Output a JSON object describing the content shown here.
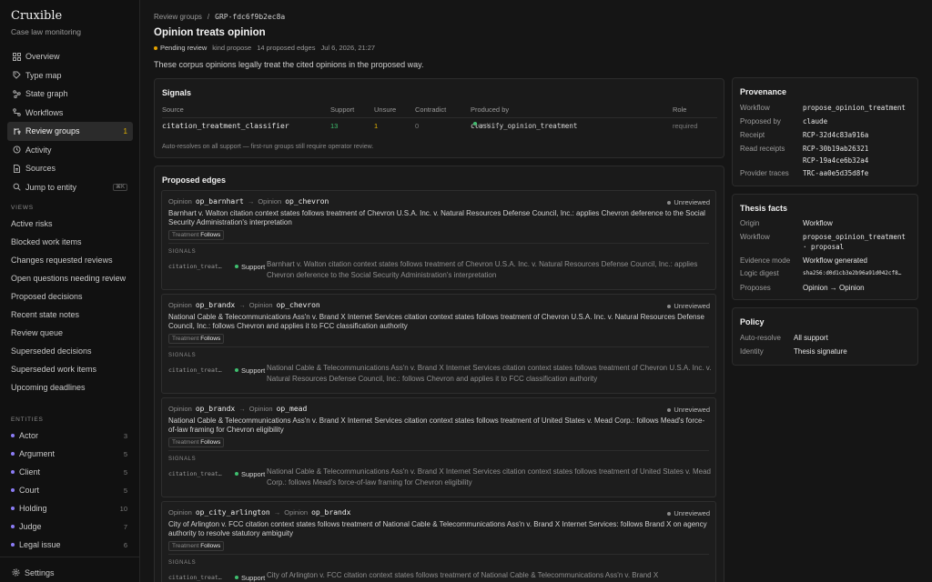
{
  "app": {
    "name": "Cruxible",
    "subtitle": "Case law monitoring"
  },
  "nav": [
    {
      "label": "Overview",
      "icon": "grid-icon"
    },
    {
      "label": "Type map",
      "icon": "tag-icon"
    },
    {
      "label": "State graph",
      "icon": "graph-icon"
    },
    {
      "label": "Workflows",
      "icon": "workflow-icon"
    },
    {
      "label": "Review groups",
      "icon": "merge-icon",
      "count": "1",
      "active": true
    },
    {
      "label": "Activity",
      "icon": "history-icon"
    },
    {
      "label": "Sources",
      "icon": "file-icon"
    },
    {
      "label": "Jump to entity",
      "icon": "search-icon",
      "kbd": "⌘K"
    }
  ],
  "views": {
    "label": "VIEWS",
    "items": [
      "Active risks",
      "Blocked work items",
      "Changes requested reviews",
      "Open questions needing review",
      "Proposed decisions",
      "Recent state notes",
      "Review queue",
      "Superseded decisions",
      "Superseded work items",
      "Upcoming deadlines"
    ]
  },
  "entities": {
    "label": "ENTITIES",
    "items": [
      {
        "label": "Actor",
        "count": "3"
      },
      {
        "label": "Argument",
        "count": "5"
      },
      {
        "label": "Client",
        "count": "5"
      },
      {
        "label": "Court",
        "count": "5"
      },
      {
        "label": "Holding",
        "count": "10"
      },
      {
        "label": "Judge",
        "count": "7"
      },
      {
        "label": "Legal issue",
        "count": "6"
      }
    ]
  },
  "settings_label": "Settings",
  "breadcrumb": {
    "parent": "Review groups",
    "sep": "/",
    "id": "GRP-fdc6f9b2ec8a"
  },
  "page": {
    "title": "Opinion treats opinion",
    "status": "Pending review",
    "kind": "kind propose",
    "edges_count": "14 proposed edges",
    "date": "Jul 6, 2026, 21:27",
    "description": "These corpus opinions legally treat the cited opinions in the proposed way."
  },
  "signals": {
    "title": "Signals",
    "headers": {
      "source": "Source",
      "support": "Support",
      "unsure": "Unsure",
      "contradict": "Contradict",
      "produced_by": "Produced by",
      "role": "Role"
    },
    "row": {
      "source": "citation_treatment_classifier",
      "support": "13",
      "unsure": "1",
      "contradict": "0",
      "produced_by": "classify_opinion_treatment",
      "verdict": ".verdict",
      "role": "required"
    },
    "note": "Auto-resolves on all support — first-run groups still require operator review."
  },
  "edges": {
    "title": "Proposed edges",
    "items": [
      {
        "from_label": "Opinion",
        "from": "op_barnhart",
        "to_label": "Opinion",
        "to": "op_chevron",
        "status": "Unreviewed",
        "text": "Barnhart v. Walton citation context states follows treatment of Chevron U.S.A. Inc. v. Natural Resources Defense Council, Inc.: applies Chevron deference to the Social Security Administration's interpretation",
        "chip_label": "Treatment",
        "chip_value": "Follows",
        "signals_label": "SIGNALS",
        "sig_source": "citation_treat…",
        "sig_verdict": "Support",
        "sig_text": "Barnhart v. Walton citation context states follows treatment of Chevron U.S.A. Inc. v. Natural Resources Defense Council, Inc.: applies Chevron deference to the Social Security Administration's interpretation"
      },
      {
        "from_label": "Opinion",
        "from": "op_brandx",
        "to_label": "Opinion",
        "to": "op_chevron",
        "status": "Unreviewed",
        "text": "National Cable & Telecommunications Ass'n v. Brand X Internet Services citation context states follows treatment of Chevron U.S.A. Inc. v. Natural Resources Defense Council, Inc.: follows Chevron and applies it to FCC classification authority",
        "chip_label": "Treatment",
        "chip_value": "Follows",
        "signals_label": "SIGNALS",
        "sig_source": "citation_treat…",
        "sig_verdict": "Support",
        "sig_text": "National Cable & Telecommunications Ass'n v. Brand X Internet Services citation context states follows treatment of Chevron U.S.A. Inc. v. Natural Resources Defense Council, Inc.: follows Chevron and applies it to FCC classification authority"
      },
      {
        "from_label": "Opinion",
        "from": "op_brandx",
        "to_label": "Opinion",
        "to": "op_mead",
        "status": "Unreviewed",
        "text": "National Cable & Telecommunications Ass'n v. Brand X Internet Services citation context states follows treatment of United States v. Mead Corp.: follows Mead's force-of-law framing for Chevron eligibility",
        "chip_label": "Treatment",
        "chip_value": "Follows",
        "signals_label": "SIGNALS",
        "sig_source": "citation_treat…",
        "sig_verdict": "Support",
        "sig_text": "National Cable & Telecommunications Ass'n v. Brand X Internet Services citation context states follows treatment of United States v. Mead Corp.: follows Mead's force-of-law framing for Chevron eligibility"
      },
      {
        "from_label": "Opinion",
        "from": "op_city_arlington",
        "to_label": "Opinion",
        "to": "op_brandx",
        "status": "Unreviewed",
        "text": "City of Arlington v. FCC citation context states follows treatment of National Cable & Telecommunications Ass'n v. Brand X Internet Services: follows Brand X on agency authority to resolve statutory ambiguity",
        "chip_label": "Treatment",
        "chip_value": "Follows",
        "signals_label": "SIGNALS",
        "sig_source": "citation_treat…",
        "sig_verdict": "Support",
        "sig_text": "City of Arlington v. FCC citation context states follows treatment of National Cable & Telecommunications Ass'n v. Brand X"
      }
    ]
  },
  "provenance": {
    "title": "Provenance",
    "workflow_k": "Workflow",
    "workflow_v": "propose_opinion_treatment",
    "proposed_k": "Proposed by",
    "proposed_v": "claude",
    "receipt_k": "Receipt",
    "receipt_v": "RCP-32d4c83a916a",
    "read_k": "Read receipts",
    "read_v1": "RCP-30b19ab26321",
    "read_v2": "RCP-19a4ce6b32a4",
    "trace_k": "Provider traces",
    "trace_v": "TRC-aa0e5d35d8fe"
  },
  "thesis": {
    "title": "Thesis facts",
    "origin_k": "Origin",
    "origin_v": "Workflow",
    "workflow_k": "Workflow",
    "workflow_v1": "propose_opinion_treatment",
    "workflow_v2": "· proposal",
    "evidence_k": "Evidence mode",
    "evidence_v": "Workflow generated",
    "digest_k": "Logic digest",
    "digest_v": "sha256:d0d1cb3e2b96a91d042cf8…",
    "proposes_k": "Proposes",
    "proposes_v": "Opinion → Opinion"
  },
  "policy": {
    "title": "Policy",
    "auto_k": "Auto-resolve",
    "auto_v": "All support",
    "identity_k": "Identity",
    "identity_v": "Thesis signature"
  }
}
